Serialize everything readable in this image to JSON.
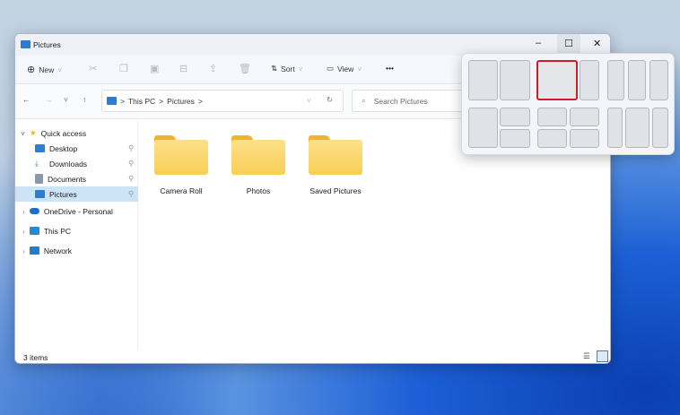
{
  "window": {
    "title": "Pictures",
    "controls": {
      "minimize": "–",
      "maximize": "☐",
      "close": "✕"
    }
  },
  "toolbar": {
    "new_label": "New",
    "sort_label": "Sort",
    "view_label": "View",
    "more": "•••"
  },
  "address": {
    "crumbs": [
      "This PC",
      "Pictures"
    ],
    "separator": ">",
    "search_placeholder": "Search Pictures"
  },
  "sidebar": {
    "quick_access": "Quick access",
    "items": [
      {
        "label": "Desktop",
        "icon": "desktop-icon",
        "color": "#2f7fd0"
      },
      {
        "label": "Downloads",
        "icon": "download-icon",
        "color": "#2e9a5a"
      },
      {
        "label": "Documents",
        "icon": "document-icon",
        "color": "#8a98a8"
      },
      {
        "label": "Pictures",
        "icon": "pictures-icon",
        "color": "#2a7dd0"
      }
    ],
    "roots": [
      {
        "label": "OneDrive - Personal",
        "icon": "cloud-icon",
        "color": "#1f6fc4"
      },
      {
        "label": "This PC",
        "icon": "computer-icon",
        "color": "#2a8ad0"
      },
      {
        "label": "Network",
        "icon": "network-icon",
        "color": "#2a7cc0"
      }
    ]
  },
  "folders": [
    "Camera Roll",
    "Photos",
    "Saved Pictures"
  ],
  "status": {
    "count": "3 items"
  },
  "snap_layouts": {
    "selected_color": "#d21b24"
  }
}
